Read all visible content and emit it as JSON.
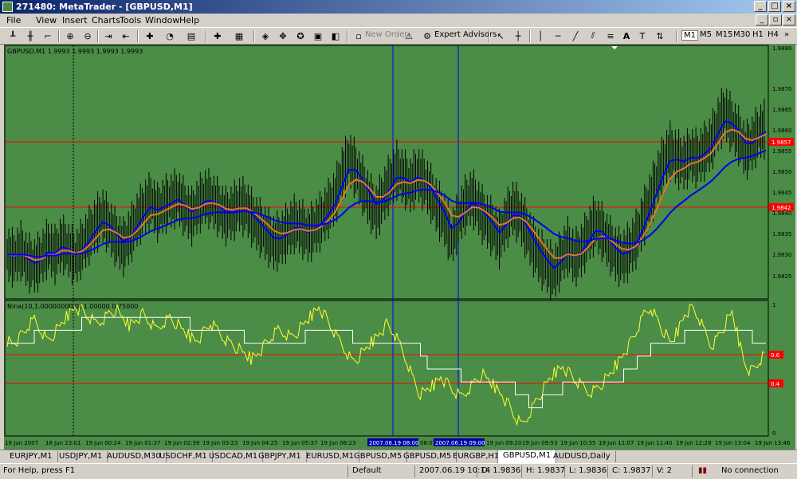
{
  "window": {
    "title": "271480: MetaTrader - [GBPUSD,M1]"
  },
  "menu": [
    "File",
    "View",
    "Insert",
    "Charts",
    "Tools",
    "Window",
    "Help"
  ],
  "toolbar": {
    "new_order": "New Order",
    "expert_advisors": "Expert Advisors",
    "text_tool": "A",
    "timeframes": [
      "M1",
      "M5",
      "M15",
      "M30",
      "H1",
      "H4"
    ]
  },
  "chart": {
    "main_label": "GBPUSD,M1  1.9993  1.9993  1.9993  1.9993",
    "indicator_label": "Nina(10,1.00000000,0)  1.00000 0.75000",
    "price_ticks": [
      "1.9880",
      "1.9870",
      "1.9865",
      "1.9860",
      "1.9855",
      "1.9850",
      "1.9845",
      "1.9840",
      "1.9835",
      "1.9830",
      "1.9825"
    ],
    "hline_labels": [
      "1.9857",
      "1.9842"
    ],
    "ind_ticks": [
      "1",
      "0"
    ],
    "ind_hline_labels": [
      "0.6",
      "0.4"
    ],
    "time_labels": [
      "18 Jun 2007",
      "18 Jun 23:01",
      "19 Jun 00:24",
      "19 Jun 01:37",
      "19 Jun 02:39",
      "19 Jun 03:23",
      "19 Jun 04:25",
      "19 Jun 05:37",
      "19 Jun 06:23",
      "2007.06.19 08:00",
      "08:03",
      "2007.06.19 09:00",
      "19 Jun 09:20",
      "19 Jun 09:53",
      "19 Jun 10:35",
      "19 Jun 11:07",
      "19 Jun 11:40",
      "19 Jun 12:28",
      "19 Jun 13:04",
      "19 Jun 13:46"
    ]
  },
  "chart_data": {
    "type": "line",
    "title": "GBPUSD,M1",
    "ylim": [
      1.982,
      1.9885
    ],
    "price_series": [
      1.9831,
      1.983,
      1.9832,
      1.9829,
      1.9828,
      1.983,
      1.9833,
      1.9831,
      1.9834,
      1.9832,
      1.983,
      1.9833,
      1.9836,
      1.9839,
      1.9841,
      1.9838,
      1.9835,
      1.9833,
      1.9836,
      1.984,
      1.9843,
      1.9845,
      1.9842,
      1.9844,
      1.9845,
      1.9846,
      1.9843,
      1.9841,
      1.9844,
      1.9846,
      1.9845,
      1.9843,
      1.9841,
      1.9842,
      1.9844,
      1.9843,
      1.984,
      1.9838,
      1.9836,
      1.9834,
      1.9835,
      1.9837,
      1.9839,
      1.9838,
      1.9836,
      1.9838,
      1.984,
      1.9843,
      1.9846,
      1.9852,
      1.9856,
      1.9853,
      1.9849,
      1.9845,
      1.9842,
      1.9846,
      1.985,
      1.9853,
      1.9851,
      1.9849,
      1.9852,
      1.985,
      1.9847,
      1.9843,
      1.984,
      1.9835,
      1.984,
      1.9844,
      1.9846,
      1.9843,
      1.984,
      1.9838,
      1.9835,
      1.984,
      1.9843,
      1.9841,
      1.9837,
      1.9833,
      1.983,
      1.9828,
      1.9826,
      1.983,
      1.9833,
      1.983,
      1.9832,
      1.9836,
      1.9839,
      1.9837,
      1.9834,
      1.9831,
      1.983,
      1.9832,
      1.9835,
      1.984,
      1.9845,
      1.985,
      1.9855,
      1.9858,
      1.9856,
      1.9855,
      1.9857,
      1.9856,
      1.9858,
      1.986,
      1.9865,
      1.9868,
      1.9865,
      1.9862,
      1.9858,
      1.986,
      1.9863,
      1.9864
    ],
    "indicator_series": [
      0.72,
      0.7,
      0.75,
      0.82,
      0.88,
      0.8,
      0.72,
      0.78,
      0.85,
      0.92,
      0.98,
      0.95,
      0.9,
      0.85,
      0.88,
      0.93,
      0.96,
      0.9,
      0.84,
      0.88,
      0.92,
      0.86,
      0.8,
      0.86,
      0.9,
      0.85,
      0.8,
      0.75,
      0.72,
      0.78,
      0.85,
      0.8,
      0.74,
      0.7,
      0.66,
      0.62,
      0.58,
      0.62,
      0.68,
      0.74,
      0.8,
      0.78,
      0.75,
      0.8,
      0.86,
      0.92,
      0.98,
      0.9,
      0.8,
      0.72,
      0.64,
      0.56,
      0.6,
      0.66,
      0.72,
      0.78,
      0.84,
      0.78,
      0.68,
      0.56,
      0.42,
      0.3,
      0.34,
      0.38,
      0.44,
      0.38,
      0.32,
      0.28,
      0.34,
      0.4,
      0.46,
      0.42,
      0.36,
      0.3,
      0.22,
      0.12,
      0.06,
      0.15,
      0.25,
      0.33,
      0.42,
      0.48,
      0.52,
      0.46,
      0.4,
      0.36,
      0.32,
      0.35,
      0.4,
      0.46,
      0.54,
      0.62,
      0.7,
      0.8,
      0.92,
      0.98,
      0.88,
      0.78,
      0.7,
      0.8,
      0.92,
      0.98,
      0.9,
      0.78,
      0.68,
      0.76,
      0.85,
      0.94,
      0.72,
      0.52,
      0.48,
      0.55,
      0.62
    ]
  }
}
